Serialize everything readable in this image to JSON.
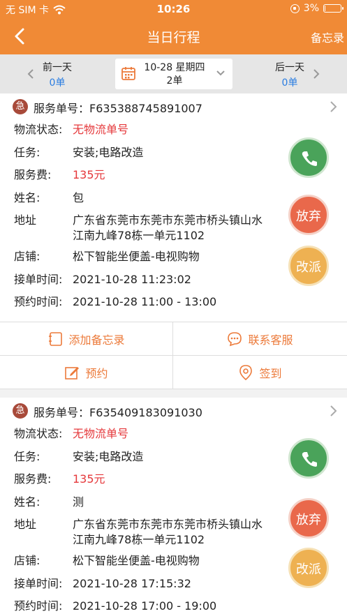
{
  "status": {
    "carrier": "无 SIM 卡",
    "time": "10:26",
    "battery": "3%",
    "battery_level": 0.03
  },
  "nav": {
    "title": "当日行程",
    "memo_label": "备忘录"
  },
  "datebar": {
    "prev_label": "前一天",
    "prev_count": "0单",
    "date_label": "10-28 星期四",
    "date_count": "2单",
    "next_label": "后一天",
    "next_count": "0单"
  },
  "labels": {
    "service_no": "服务单号：",
    "logistics": "物流状态:",
    "task": "任务:",
    "fee": "服务费:",
    "name": "姓名:",
    "address": "地址",
    "shop": "店铺:",
    "accept_time": "接单时间:",
    "appoint_time": "预约时间:",
    "urgent": "急",
    "give_up": "放弃",
    "transfer": "改派"
  },
  "orders": [
    {
      "service_no": "F635388745891007",
      "logistics": "无物流单号",
      "task": "安装;电路改造",
      "fee": "135元",
      "name": "包",
      "address": "广东省东莞市东莞市东莞市桥头镇山水江南九峰78栋一单元1102",
      "shop": "松下智能坐便盖-电视购物",
      "accept_time": "2021-10-28 11:23:02",
      "appoint_time": "2021-10-28 11:00 - 13:00"
    },
    {
      "service_no": "F635409183091030",
      "logistics": "无物流单号",
      "task": "安装;电路改造",
      "fee": "135元",
      "name": "测",
      "address": "广东省东莞市东莞市东莞市桥头镇山水江南九峰78栋一单元1102",
      "shop": "松下智能坐便盖-电视购物",
      "accept_time": "2021-10-28 17:15:32",
      "appoint_time": "2021-10-28 17:00 - 19:00"
    }
  ],
  "actions": {
    "add_memo": "添加备忘录",
    "contact_service": "联系客服",
    "appoint": "预约",
    "check_in": "签到"
  },
  "colors": {
    "brand": "#f08a36",
    "accent": "#ec7a3a",
    "price": "#e5383b",
    "count": "#2a7de1"
  }
}
